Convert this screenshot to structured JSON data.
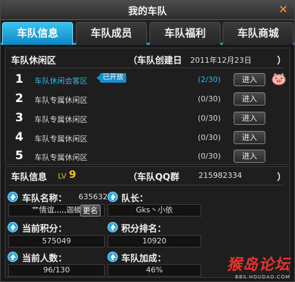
{
  "window": {
    "title": "我的车队",
    "close_glyph": "✕"
  },
  "tabs": [
    {
      "label": "车队信息",
      "active": true
    },
    {
      "label": "车队成员",
      "active": false
    },
    {
      "label": "车队福利",
      "active": false
    },
    {
      "label": "车队商城",
      "active": false
    }
  ],
  "lounge": {
    "heading": "车队休闲区",
    "created_label": "（车队创建日",
    "created_date": "2011年12月23日",
    "created_close": "）",
    "open_badge": "已开放",
    "enter_label": "进入",
    "rows": [
      {
        "num": "1",
        "name": "车队休闲会客区",
        "count": "(2/30)",
        "open": true,
        "has_pig": true
      },
      {
        "num": "2",
        "name": "车队专属休闲区",
        "count": "(0/30)",
        "open": false,
        "has_pig": false
      },
      {
        "num": "3",
        "name": "车队专属休闲区",
        "count": "(0/30)",
        "open": false,
        "has_pig": false
      },
      {
        "num": "4",
        "name": "车队专属休闲区",
        "count": "(0/30)",
        "open": false,
        "has_pig": false
      },
      {
        "num": "5",
        "name": "车队专属休闲区",
        "count": "(0/30)",
        "open": false,
        "has_pig": false
      }
    ]
  },
  "team_info": {
    "heading": "车队信息",
    "level_prefix": "LV",
    "level": "9",
    "qq_label": "（车队QQ群",
    "qq_number": "215982334",
    "qq_close": "）",
    "name_label": "车队名称：",
    "name_id": "635632",
    "name_value": "艹情谊,,,,,迦蝬",
    "rename_button": "更名",
    "captain_label": "队长：",
    "captain_value": "Gks丶小依",
    "points_label": "当前积分：",
    "points_value": "575049",
    "rank_label": "积分排名：",
    "rank_value": "10920",
    "members_label": "当前人数：",
    "members_value": "96/130",
    "bonus_label": "车队加成：",
    "bonus_value": "46%"
  },
  "watermark": {
    "main": "猴岛论坛",
    "sub": "BBS.HOUDAO.COM"
  },
  "colors": {
    "accent": "#19a6d6",
    "open_text": "#2fb7e8",
    "close": "#ff9a2a",
    "watermark": "#e8342c"
  }
}
